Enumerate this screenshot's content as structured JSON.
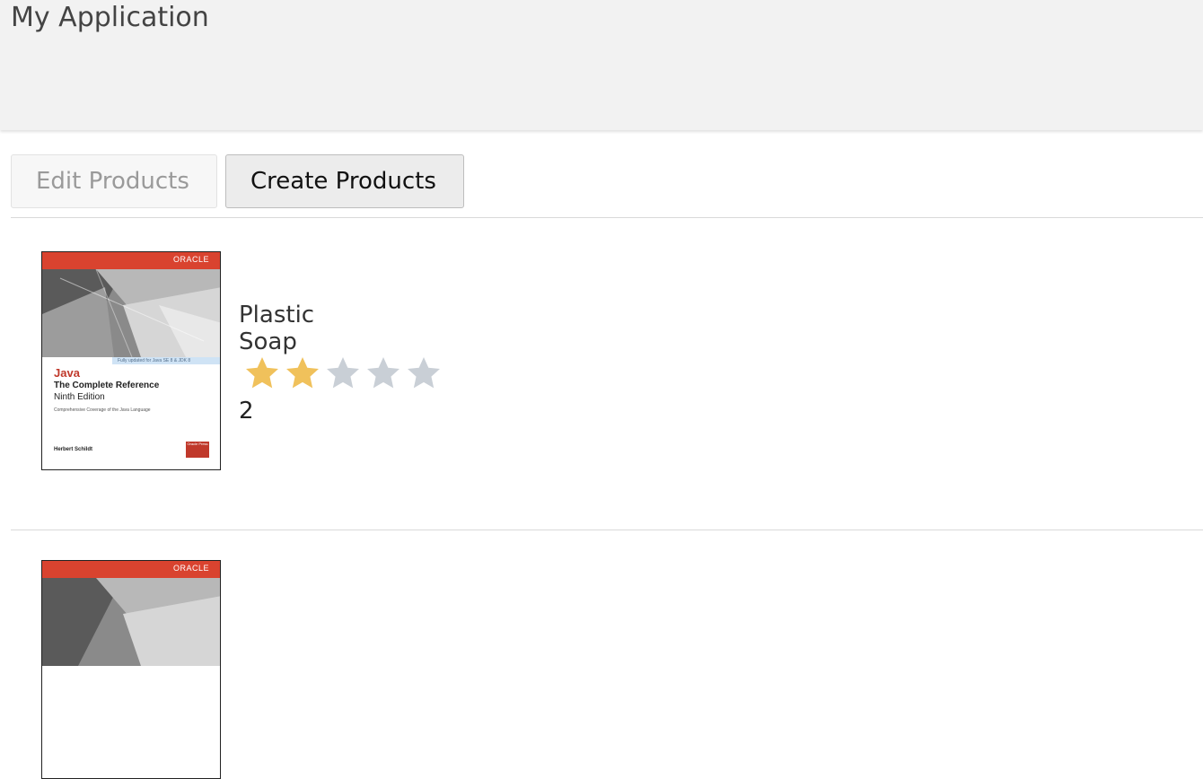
{
  "app": {
    "title": "My Application"
  },
  "tabs": [
    {
      "label": "Edit Products",
      "state": "disabled"
    },
    {
      "label": "Create Products",
      "state": "active"
    }
  ],
  "products": [
    {
      "name": "Plastic Soap",
      "rating": 2,
      "rating_max": 5,
      "rating_text": "2",
      "cover": {
        "brand": "ORACLE",
        "badge": "Fully updated for Java SE 8 & JDK 8",
        "title": "Java",
        "subtitle": "The Complete Reference",
        "edition": "Ninth Edition",
        "description": "Comprehensive Coverage of the Java Language",
        "author": "Herbert Schildt",
        "press": "Oracle Press"
      }
    },
    {
      "cover": {
        "brand": "ORACLE"
      }
    }
  ],
  "colors": {
    "star_filled": "#f0c15b",
    "star_empty": "#c9cfd6",
    "header_bg": "#f2f2f2",
    "cover_red": "#d9432f"
  }
}
